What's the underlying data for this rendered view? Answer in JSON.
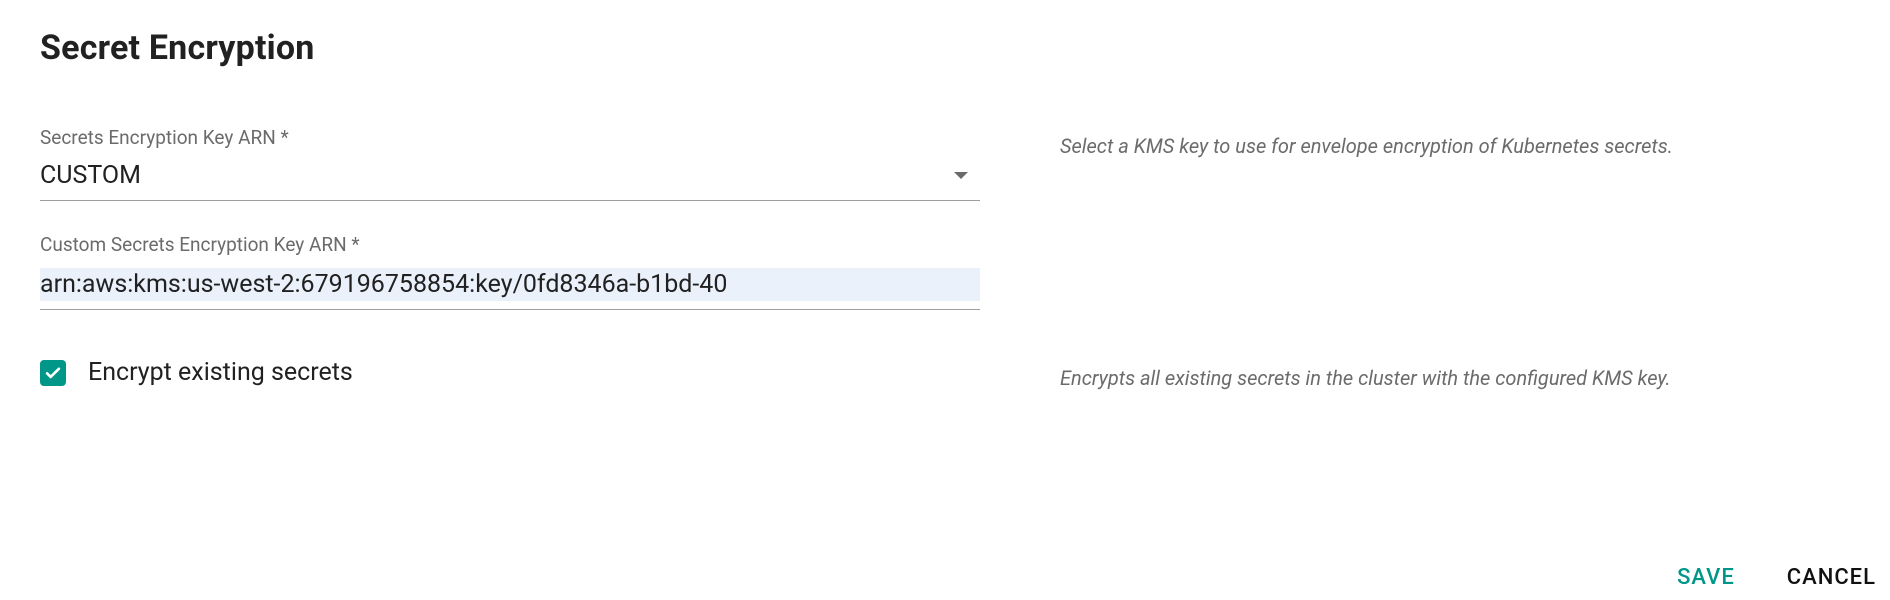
{
  "title": "Secret Encryption",
  "fields": {
    "key_arn": {
      "label": "Secrets Encryption Key ARN *",
      "value": "CUSTOM",
      "helper": "Select a KMS key to use for envelope encryption of Kubernetes secrets."
    },
    "custom_arn": {
      "label": "Custom Secrets Encryption Key ARN *",
      "value": "arn:aws:kms:us-west-2:679196758854:key/0fd8346a-b1bd-40"
    },
    "encrypt_existing": {
      "label": "Encrypt existing secrets",
      "checked": true,
      "helper": "Encrypts all existing secrets in the cluster with the configured KMS key."
    }
  },
  "actions": {
    "save": "SAVE",
    "cancel": "CANCEL"
  },
  "colors": {
    "accent": "#009688"
  }
}
